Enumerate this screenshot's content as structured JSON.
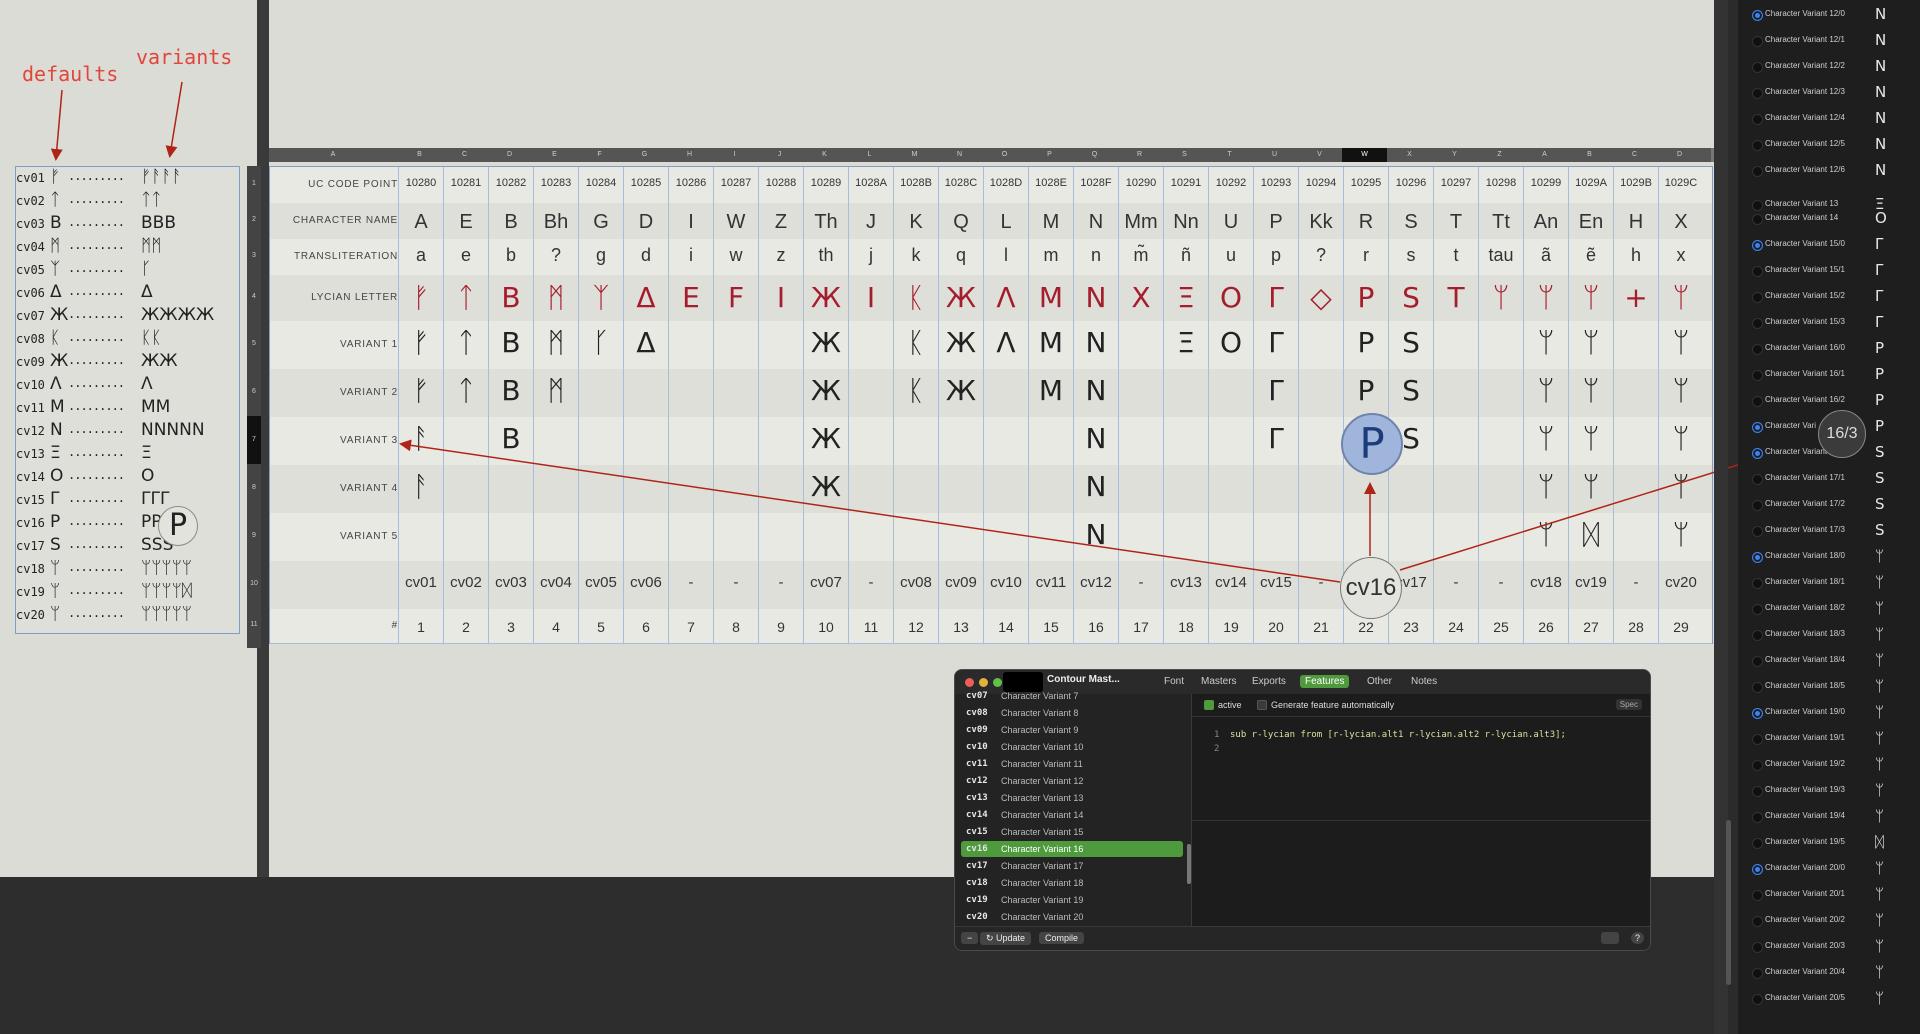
{
  "annotations": {
    "defaults": "defaults",
    "variants": "variants"
  },
  "left_panel": {
    "rows": [
      {
        "tag": "cv01",
        "def": "ᚠ",
        "var": "ᚠᚨᚨᚨ"
      },
      {
        "tag": "cv02",
        "def": "ᛏ",
        "var": "ᛏᛏ"
      },
      {
        "tag": "cv03",
        "def": "B",
        "var": "BBB"
      },
      {
        "tag": "cv04",
        "def": "ᛗ",
        "var": "ᛗᛗ"
      },
      {
        "tag": "cv05",
        "def": "ᛉ",
        "var": "ᚴ"
      },
      {
        "tag": "cv06",
        "def": "Δ",
        "var": "Δ"
      },
      {
        "tag": "cv07",
        "def": "Ж",
        "var": "ЖЖЖЖ"
      },
      {
        "tag": "cv08",
        "def": "ᛕ",
        "var": "ᛕᛕ"
      },
      {
        "tag": "cv09",
        "def": "Ж",
        "var": "ЖЖ"
      },
      {
        "tag": "cv10",
        "def": "Λ",
        "var": "Λ"
      },
      {
        "tag": "cv11",
        "def": "M",
        "var": "MM"
      },
      {
        "tag": "cv12",
        "def": "N",
        "var": "NNNNN"
      },
      {
        "tag": "cv13",
        "def": "Ξ",
        "var": "Ξ"
      },
      {
        "tag": "cv14",
        "def": "O",
        "var": "O"
      },
      {
        "tag": "cv15",
        "def": "Γ",
        "var": "ΓΓΓ"
      },
      {
        "tag": "cv16",
        "def": "P",
        "var": "PP"
      },
      {
        "tag": "cv17",
        "def": "S",
        "var": "SSS"
      },
      {
        "tag": "cv18",
        "def": "ᛘ",
        "var": "ᛘᛘᛘᛘᛘ"
      },
      {
        "tag": "cv19",
        "def": "ᛘ",
        "var": "ᛘᛘᛘᛘᛞ"
      },
      {
        "tag": "cv20",
        "def": "ᛘ",
        "var": "ᛘᛘᛘᛘᛘ"
      }
    ],
    "dots": "........."
  },
  "sheet": {
    "col_letters": [
      "A",
      "B",
      "C",
      "D",
      "E",
      "F",
      "G",
      "H",
      "I",
      "J",
      "K",
      "L",
      "M",
      "N",
      "O",
      "P",
      "Q",
      "R",
      "S",
      "T",
      "U",
      "V",
      "W",
      "X",
      "Y",
      "Z",
      "A",
      "B",
      "C",
      "D"
    ],
    "row_numbers": [
      "1",
      "2",
      "3",
      "4",
      "5",
      "6",
      "7",
      "8",
      "9",
      "10",
      "11"
    ],
    "row_labels": [
      "UC CODE POINT",
      "CHARACTER NAME",
      "TRANSLITERATION",
      "LYCIAN LETTER",
      "VARIANT 1",
      "VARIANT 2",
      "VARIANT 3",
      "VARIANT 4",
      "VARIANT 5",
      "",
      "#"
    ],
    "code_points": [
      "10280",
      "10281",
      "10282",
      "10283",
      "10284",
      "10285",
      "10286",
      "10287",
      "10288",
      "10289",
      "1028A",
      "1028B",
      "1028C",
      "1028D",
      "1028E",
      "1028F",
      "10290",
      "10291",
      "10292",
      "10293",
      "10294",
      "10295",
      "10296",
      "10297",
      "10298",
      "10299",
      "1029A",
      "1029B",
      "1029C"
    ],
    "names": [
      "A",
      "E",
      "B",
      "Bh",
      "G",
      "D",
      "I",
      "W",
      "Z",
      "Th",
      "J",
      "K",
      "Q",
      "L",
      "M",
      "N",
      "Mm",
      "Nn",
      "U",
      "P",
      "Kk",
      "R",
      "S",
      "T",
      "Tt",
      "An",
      "En",
      "H",
      "X"
    ],
    "translit": [
      "a",
      "e",
      "b",
      "?",
      "g",
      "d",
      "i",
      "w",
      "z",
      "th",
      "j",
      "k",
      "q",
      "l",
      "m",
      "n",
      "m̃",
      "ñ",
      "u",
      "p",
      "?",
      "r",
      "s",
      "t",
      "tau",
      "ã",
      "ẽ",
      "h",
      "x"
    ],
    "lycian": [
      "ᚠ",
      "ᛏ",
      "B",
      "ᛗ",
      "ᛉ",
      "Δ",
      "E",
      "F",
      "I",
      "Ж",
      "I",
      "ᛕ",
      "Ж",
      "Λ",
      "M",
      "N",
      "X",
      "Ξ",
      "O",
      "Γ",
      "◇",
      "P",
      "S",
      "T",
      "ᛘ",
      "ᛘ",
      "ᛘ",
      "+",
      "ᛘ"
    ],
    "variant1": [
      "ᚠ",
      "ᛏ",
      "B",
      "ᛗ",
      "ᚴ",
      "Δ",
      "",
      "",
      "",
      "Ж",
      "",
      "ᛕ",
      "Ж",
      "Λ",
      "M",
      "N",
      "",
      "Ξ",
      "O",
      "Γ",
      "",
      "P",
      "S",
      "",
      "",
      "ᛘ",
      "ᛘ",
      "",
      "ᛘ"
    ],
    "variant2": [
      "ᚠ",
      "ᛏ",
      "B",
      "ᛗ",
      "",
      "",
      "",
      "",
      "",
      "Ж",
      "",
      "ᛕ",
      "Ж",
      "",
      "M",
      "N",
      "",
      "",
      "",
      "Γ",
      "",
      "P",
      "S",
      "",
      "",
      "ᛘ",
      "ᛘ",
      "",
      "ᛘ"
    ],
    "variant3": [
      "ᚨ",
      "",
      "B",
      "",
      "",
      "",
      "",
      "",
      "",
      "Ж",
      "",
      "",
      "",
      "",
      "",
      "N",
      "",
      "",
      "",
      "Γ",
      "",
      "P",
      "S",
      "",
      "",
      "ᛘ",
      "ᛘ",
      "",
      "ᛘ"
    ],
    "variant4": [
      "ᚨ",
      "",
      "",
      "",
      "",
      "",
      "",
      "",
      "",
      "Ж",
      "",
      "",
      "",
      "",
      "",
      "N",
      "",
      "",
      "",
      "",
      "",
      "",
      "",
      "",
      "",
      "ᛘ",
      "ᛘ",
      "",
      "ᛘ"
    ],
    "variant5": [
      "",
      "",
      "",
      "",
      "",
      "",
      "",
      "",
      "",
      "",
      "",
      "",
      "",
      "",
      "",
      "N",
      "",
      "",
      "",
      "",
      "",
      "",
      "",
      "",
      "",
      "ᛘ",
      "ᛞ",
      "",
      "ᛘ"
    ],
    "cv_tags": [
      "cv01",
      "cv02",
      "cv03",
      "cv04",
      "cv05",
      "cv06",
      "-",
      "-",
      "-",
      "cv07",
      "-",
      "cv08",
      "cv09",
      "cv10",
      "cv11",
      "cv12",
      "-",
      "cv13",
      "cv14",
      "cv15",
      "-",
      "cv16",
      "cv17",
      "-",
      "-",
      "cv18",
      "cv19",
      "-",
      "cv20"
    ],
    "numbers": [
      "1",
      "2",
      "3",
      "4",
      "5",
      "6",
      "7",
      "8",
      "9",
      "10",
      "11",
      "12",
      "13",
      "14",
      "15",
      "16",
      "17",
      "18",
      "19",
      "20",
      "21",
      "22",
      "23",
      "24",
      "25",
      "26",
      "27",
      "28",
      "29"
    ]
  },
  "callouts": {
    "p_glyph": "P",
    "cv16": "cv16",
    "index": "16/3",
    "left_glyph": "P"
  },
  "right_panel": {
    "items": [
      {
        "label": "Character Variant 12/0",
        "on": true,
        "glyph": "N"
      },
      {
        "label": "Character Variant 12/1",
        "on": false,
        "glyph": "N"
      },
      {
        "label": "Character Variant 12/2",
        "on": false,
        "glyph": "N"
      },
      {
        "label": "Character Variant 12/3",
        "on": false,
        "glyph": "N"
      },
      {
        "label": "Character Variant 12/4",
        "on": false,
        "glyph": "N"
      },
      {
        "label": "Character Variant 12/5",
        "on": false,
        "glyph": "N"
      },
      {
        "label": "Character Variant 12/6",
        "on": false,
        "glyph": "N"
      },
      {
        "label": "Character Variant 13",
        "on": false,
        "glyph": "Ξ"
      },
      {
        "label": "Character Variant 14",
        "on": false,
        "glyph": "O"
      },
      {
        "label": "Character Variant 15/0",
        "on": true,
        "glyph": "Γ"
      },
      {
        "label": "Character Variant 15/1",
        "on": false,
        "glyph": "Γ"
      },
      {
        "label": "Character Variant 15/2",
        "on": false,
        "glyph": "Γ"
      },
      {
        "label": "Character Variant 15/3",
        "on": false,
        "glyph": "Γ"
      },
      {
        "label": "Character Variant 16/0",
        "on": false,
        "glyph": "P"
      },
      {
        "label": "Character Variant 16/1",
        "on": false,
        "glyph": "P"
      },
      {
        "label": "Character Variant 16/2",
        "on": false,
        "glyph": "P"
      },
      {
        "label": "Character Vari",
        "on": true,
        "glyph": "P"
      },
      {
        "label": "Character Variant 17/0",
        "on": true,
        "glyph": "S"
      },
      {
        "label": "Character Variant 17/1",
        "on": false,
        "glyph": "S"
      },
      {
        "label": "Character Variant 17/2",
        "on": false,
        "glyph": "S"
      },
      {
        "label": "Character Variant 17/3",
        "on": false,
        "glyph": "S"
      },
      {
        "label": "Character Variant 18/0",
        "on": true,
        "glyph": "ᛘ"
      },
      {
        "label": "Character Variant 18/1",
        "on": false,
        "glyph": "ᛘ"
      },
      {
        "label": "Character Variant 18/2",
        "on": false,
        "glyph": "ᛘ"
      },
      {
        "label": "Character Variant 18/3",
        "on": false,
        "glyph": "ᛘ"
      },
      {
        "label": "Character Variant 18/4",
        "on": false,
        "glyph": "ᛘ"
      },
      {
        "label": "Character Variant 18/5",
        "on": false,
        "glyph": "ᛘ"
      },
      {
        "label": "Character Variant 19/0",
        "on": true,
        "glyph": "ᛘ"
      },
      {
        "label": "Character Variant 19/1",
        "on": false,
        "glyph": "ᛘ"
      },
      {
        "label": "Character Variant 19/2",
        "on": false,
        "glyph": "ᛘ"
      },
      {
        "label": "Character Variant 19/3",
        "on": false,
        "glyph": "ᛘ"
      },
      {
        "label": "Character Variant 19/4",
        "on": false,
        "glyph": "ᛘ"
      },
      {
        "label": "Character Variant 19/5",
        "on": false,
        "glyph": "ᛞ"
      },
      {
        "label": "Character Variant 20/0",
        "on": true,
        "glyph": "ᛘ"
      },
      {
        "label": "Character Variant 20/1",
        "on": false,
        "glyph": "ᛘ"
      },
      {
        "label": "Character Variant 20/2",
        "on": false,
        "glyph": "ᛘ"
      },
      {
        "label": "Character Variant 20/3",
        "on": false,
        "glyph": "ᛘ"
      },
      {
        "label": "Character Variant 20/4",
        "on": false,
        "glyph": "ᛘ"
      },
      {
        "label": "Character Variant 20/5",
        "on": false,
        "glyph": "ᛘ"
      }
    ]
  },
  "dialog": {
    "title": "Contour Mast...",
    "tabs": [
      "Font",
      "Masters",
      "Exports",
      "Features",
      "Other",
      "Notes"
    ],
    "active_tab": "Features",
    "list": [
      {
        "tag": "cv07",
        "name": "Character Variant 7"
      },
      {
        "tag": "cv08",
        "name": "Character Variant 8"
      },
      {
        "tag": "cv09",
        "name": "Character Variant 9"
      },
      {
        "tag": "cv10",
        "name": "Character Variant 10"
      },
      {
        "tag": "cv11",
        "name": "Character Variant 11"
      },
      {
        "tag": "cv12",
        "name": "Character Variant 12"
      },
      {
        "tag": "cv13",
        "name": "Character Variant 13"
      },
      {
        "tag": "cv14",
        "name": "Character Variant 14"
      },
      {
        "tag": "cv15",
        "name": "Character Variant 15"
      },
      {
        "tag": "cv16",
        "name": "Character Variant 16"
      },
      {
        "tag": "cv17",
        "name": "Character Variant 17"
      },
      {
        "tag": "cv18",
        "name": "Character Variant 18"
      },
      {
        "tag": "cv19",
        "name": "Character Variant 19"
      },
      {
        "tag": "cv20",
        "name": "Character Variant 20"
      }
    ],
    "selected": "cv16",
    "active_label": "active",
    "generate_label": "Generate feature automatically",
    "spec_label": "Spec",
    "line1": "1",
    "line2": "2",
    "code": "sub r-lycian from [r-lycian.alt1 r-lycian.alt2 r-lycian.alt3];",
    "minus_label": "−",
    "update_label": "↻ Update",
    "compile_label": "Compile",
    "help_label": "?"
  },
  "colors": {
    "lycian_red": "#a51d2c",
    "accent_green": "#4e9a3d",
    "radio_blue": "#3b82f6",
    "arrow": "#b02418"
  }
}
